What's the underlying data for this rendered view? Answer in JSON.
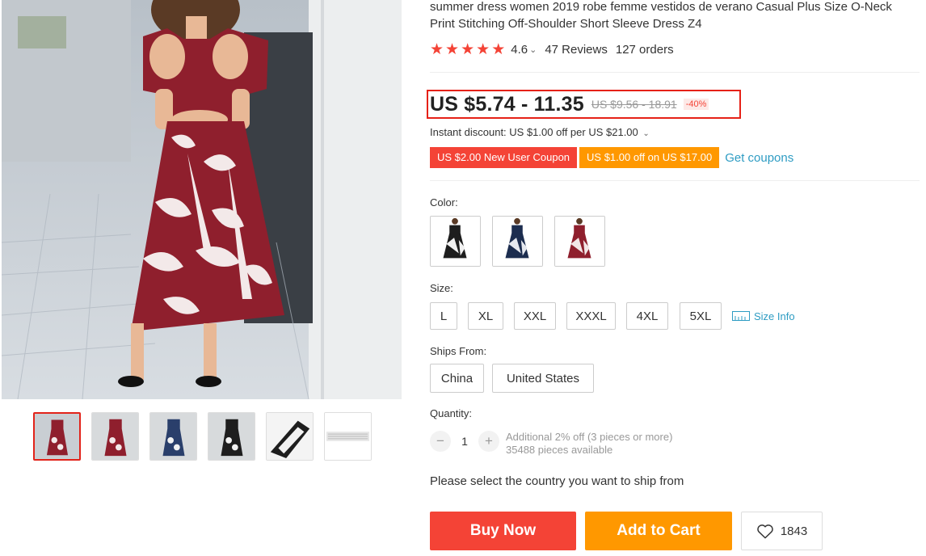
{
  "product": {
    "title": "summer dress women 2019 robe femme vestidos de verano Casual Plus Size O-Neck Print Stitching Off-Shoulder Short Sleeve Dress Z4",
    "rating": "4.6",
    "reviews": "47 Reviews",
    "orders": "127 orders"
  },
  "price": {
    "current": "US $5.74 - 11.35",
    "original": "US $9.56 - 18.91",
    "discount": "-40%"
  },
  "instant_discount": "Instant discount: US $1.00 off per US $21.00",
  "coupons": {
    "new_user": "US $2.00 New User Coupon",
    "store": "US $1.00 off on US $17.00",
    "get_link": "Get coupons"
  },
  "color": {
    "label": "Color:",
    "options": [
      {
        "name": "black-white",
        "top": "#1e1e1e",
        "skirt": "#f2f2f2",
        "pattern": "#1e1e1e"
      },
      {
        "name": "navy-white",
        "top": "#1c2d4f",
        "skirt": "#f2f2f2",
        "pattern": "#2a3f6b"
      },
      {
        "name": "wine-red",
        "top": "#8f1f2d",
        "skirt": "#f2e6e6",
        "pattern": "#8f1f2d"
      }
    ]
  },
  "size": {
    "label": "Size:",
    "options": [
      "L",
      "XL",
      "XXL",
      "XXXL",
      "4XL",
      "5XL"
    ],
    "info_link": "Size Info"
  },
  "ships_from": {
    "label": "Ships From:",
    "options": [
      "China",
      "United States"
    ]
  },
  "quantity": {
    "label": "Quantity:",
    "minus": "−",
    "value": "1",
    "plus": "+",
    "note_line1": "Additional 2% off (3 pieces or more)",
    "note_line2": "35488 pieces available"
  },
  "ship_message": "Please select the country you want to ship from",
  "buttons": {
    "buy_now": "Buy Now",
    "add_to_cart": "Add to Cart",
    "wishlist_count": "1843"
  },
  "colors": {
    "accent_red": "#f44336",
    "accent_orange": "#ff9800",
    "link_blue": "#2e9cc3",
    "highlight_border": "#e62117"
  },
  "icons": [
    "star-icon",
    "chevron-down-icon",
    "ruler-icon",
    "heart-icon",
    "minus-icon",
    "plus-icon"
  ]
}
